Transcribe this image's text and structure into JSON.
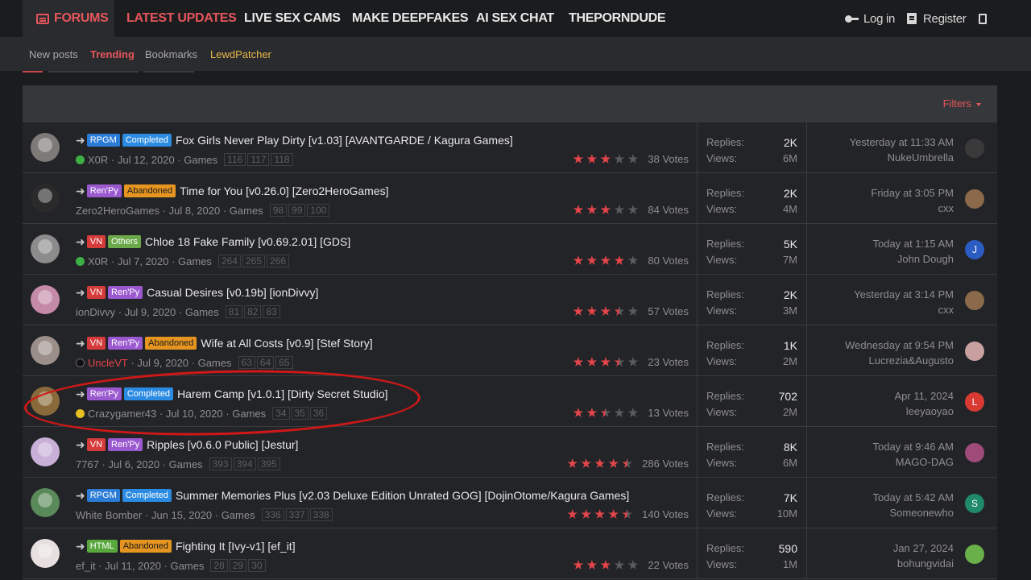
{
  "nav": {
    "forums": "FORUMS",
    "latest": "LATEST UPDATES",
    "cams": "LIVE SEX CAMS",
    "deepfakes": "MAKE DEEPFAKES",
    "ai_chat": "AI SEX CHAT",
    "dude": "THEPORNDUDE",
    "login": "Log in",
    "register": "Register"
  },
  "subnav": {
    "new_posts": "New posts",
    "trending": "Trending",
    "bookmarks": "Bookmarks",
    "lewdpatcher": "LewdPatcher"
  },
  "filters_label": "Filters",
  "labels": {
    "replies": "Replies:",
    "views": "Views:"
  },
  "colors": {
    "accent": "#e5565c",
    "engine_rpgm": "#2b7cd6",
    "engine_renpy": "#9b59d0",
    "engine_vn": "#d63b3b",
    "engine_html": "#59a83d",
    "status_completed": "#2b8ae2",
    "status_abandoned": "#e69520"
  },
  "threads": [
    {
      "tags": [
        {
          "t": "RPGM",
          "c": "rpgm"
        },
        {
          "t": "Completed",
          "c": "completed"
        }
      ],
      "title": "Fox Girls Never Play Dirty [v1.03] [AVANTGARDE / Kagura Games]",
      "author": "X0R",
      "author_icon": "green",
      "date": "Jul 12, 2020",
      "forum": "Games",
      "pages": [
        "116",
        "117",
        "118"
      ],
      "rating": 3,
      "votes": "38 Votes",
      "replies": "2K",
      "views": "6M",
      "last_date": "Yesterday at 11:33 AM",
      "last_user": "NukeUmbrella",
      "last_avatar": "",
      "last_color": "#3a3a3a"
    },
    {
      "tags": [
        {
          "t": "Ren'Py",
          "c": "renpy"
        },
        {
          "t": "Abandoned",
          "c": "abandoned"
        }
      ],
      "title": "Time for You [v0.26.0] [Zero2HeroGames]",
      "author": "Zero2HeroGames",
      "author_icon": "",
      "date": "Jul 8, 2020",
      "forum": "Games",
      "pages": [
        "98",
        "99",
        "100"
      ],
      "rating": 3,
      "votes": "84 Votes",
      "replies": "2K",
      "views": "4M",
      "last_date": "Friday at 3:05 PM",
      "last_user": "cxx",
      "last_avatar": "",
      "last_color": "#8a6a4a"
    },
    {
      "tags": [
        {
          "t": "VN",
          "c": "vn"
        },
        {
          "t": "Others",
          "c": "others"
        }
      ],
      "title": "Chloe 18 Fake Family [v0.69.2.01] [GDS]",
      "author": "X0R",
      "author_icon": "green",
      "date": "Jul 7, 2020",
      "forum": "Games",
      "pages": [
        "264",
        "265",
        "266"
      ],
      "rating": 4,
      "votes": "80 Votes",
      "replies": "5K",
      "views": "7M",
      "last_date": "Today at 1:15 AM",
      "last_user": "John Dough",
      "last_avatar": "J",
      "last_color": "#2a5cc4"
    },
    {
      "tags": [
        {
          "t": "VN",
          "c": "vn"
        },
        {
          "t": "Ren'Py",
          "c": "renpy"
        }
      ],
      "title": "Casual Desires [v0.19b] [ionDivvy]",
      "author": "ionDivvy",
      "author_icon": "",
      "date": "Jul 9, 2020",
      "forum": "Games",
      "pages": [
        "81",
        "82",
        "83"
      ],
      "rating": 3.5,
      "votes": "57 Votes",
      "replies": "2K",
      "views": "3M",
      "last_date": "Yesterday at 3:14 PM",
      "last_user": "cxx",
      "last_avatar": "",
      "last_color": "#8a6a4a"
    },
    {
      "tags": [
        {
          "t": "VN",
          "c": "vn"
        },
        {
          "t": "Ren'Py",
          "c": "renpy"
        },
        {
          "t": "Abandoned",
          "c": "abandoned"
        }
      ],
      "title": "Wife at All Costs [v0.9] [Stef Story]",
      "author": "UncleVT",
      "author_icon": "dark",
      "author_red": true,
      "date": "Jul 9, 2020",
      "forum": "Games",
      "pages": [
        "63",
        "64",
        "65"
      ],
      "rating": 3.5,
      "votes": "23 Votes",
      "replies": "1K",
      "views": "2M",
      "last_date": "Wednesday at 9:54 PM",
      "last_user": "Lucrezia&Augusto",
      "last_avatar": "",
      "last_color": "#c8a0a0"
    },
    {
      "tags": [
        {
          "t": "Ren'Py",
          "c": "renpy"
        },
        {
          "t": "Completed",
          "c": "completed"
        }
      ],
      "title": "Harem Camp [v1.0.1] [Dirty Secret Studio]",
      "author": "Crazygamer43",
      "author_icon": "yellow",
      "date": "Jul 10, 2020",
      "forum": "Games",
      "pages": [
        "34",
        "35",
        "36"
      ],
      "rating": 2.5,
      "votes": "13 Votes",
      "replies": "702",
      "views": "2M",
      "last_date": "Apr 11, 2024",
      "last_user": "leeyaoyao",
      "last_avatar": "L",
      "last_color": "#d83a32"
    },
    {
      "tags": [
        {
          "t": "VN",
          "c": "vn"
        },
        {
          "t": "Ren'Py",
          "c": "renpy"
        }
      ],
      "title": "Ripples [v0.6.0 Public] [Jestur]",
      "author": "7767",
      "author_icon": "",
      "date": "Jul 6, 2020",
      "forum": "Games",
      "pages": [
        "393",
        "394",
        "395"
      ],
      "rating": 4.5,
      "votes": "286 Votes",
      "replies": "8K",
      "views": "6M",
      "last_date": "Today at 9:46 AM",
      "last_user": "MAGO-DAG",
      "last_avatar": "",
      "last_color": "#a04a7a"
    },
    {
      "tags": [
        {
          "t": "RPGM",
          "c": "rpgm"
        },
        {
          "t": "Completed",
          "c": "completed"
        }
      ],
      "title": "Summer Memories Plus [v2.03 Deluxe Edition Unrated GOG] [DojinOtome/Kagura Games]",
      "author": "White Bomber",
      "author_icon": "",
      "date": "Jun 15, 2020",
      "forum": "Games",
      "pages": [
        "336",
        "337",
        "338"
      ],
      "rating": 4.5,
      "votes": "140 Votes",
      "replies": "7K",
      "views": "10M",
      "last_date": "Today at 5:42 AM",
      "last_user": "Someonewho",
      "last_avatar": "S",
      "last_color": "#1e8a6a"
    },
    {
      "tags": [
        {
          "t": "HTML",
          "c": "html"
        },
        {
          "t": "Abandoned",
          "c": "abandoned"
        }
      ],
      "title": "Fighting It [Ivy-v1] [ef_it]",
      "author": "ef_it",
      "author_icon": "",
      "date": "Jul 11, 2020",
      "forum": "Games",
      "pages": [
        "28",
        "29",
        "30"
      ],
      "rating": 3,
      "votes": "22 Votes",
      "replies": "590",
      "views": "1M",
      "last_date": "Jan 27, 2024",
      "last_user": "bohungvidai",
      "last_avatar": "",
      "last_color": "#6ab04a"
    }
  ]
}
